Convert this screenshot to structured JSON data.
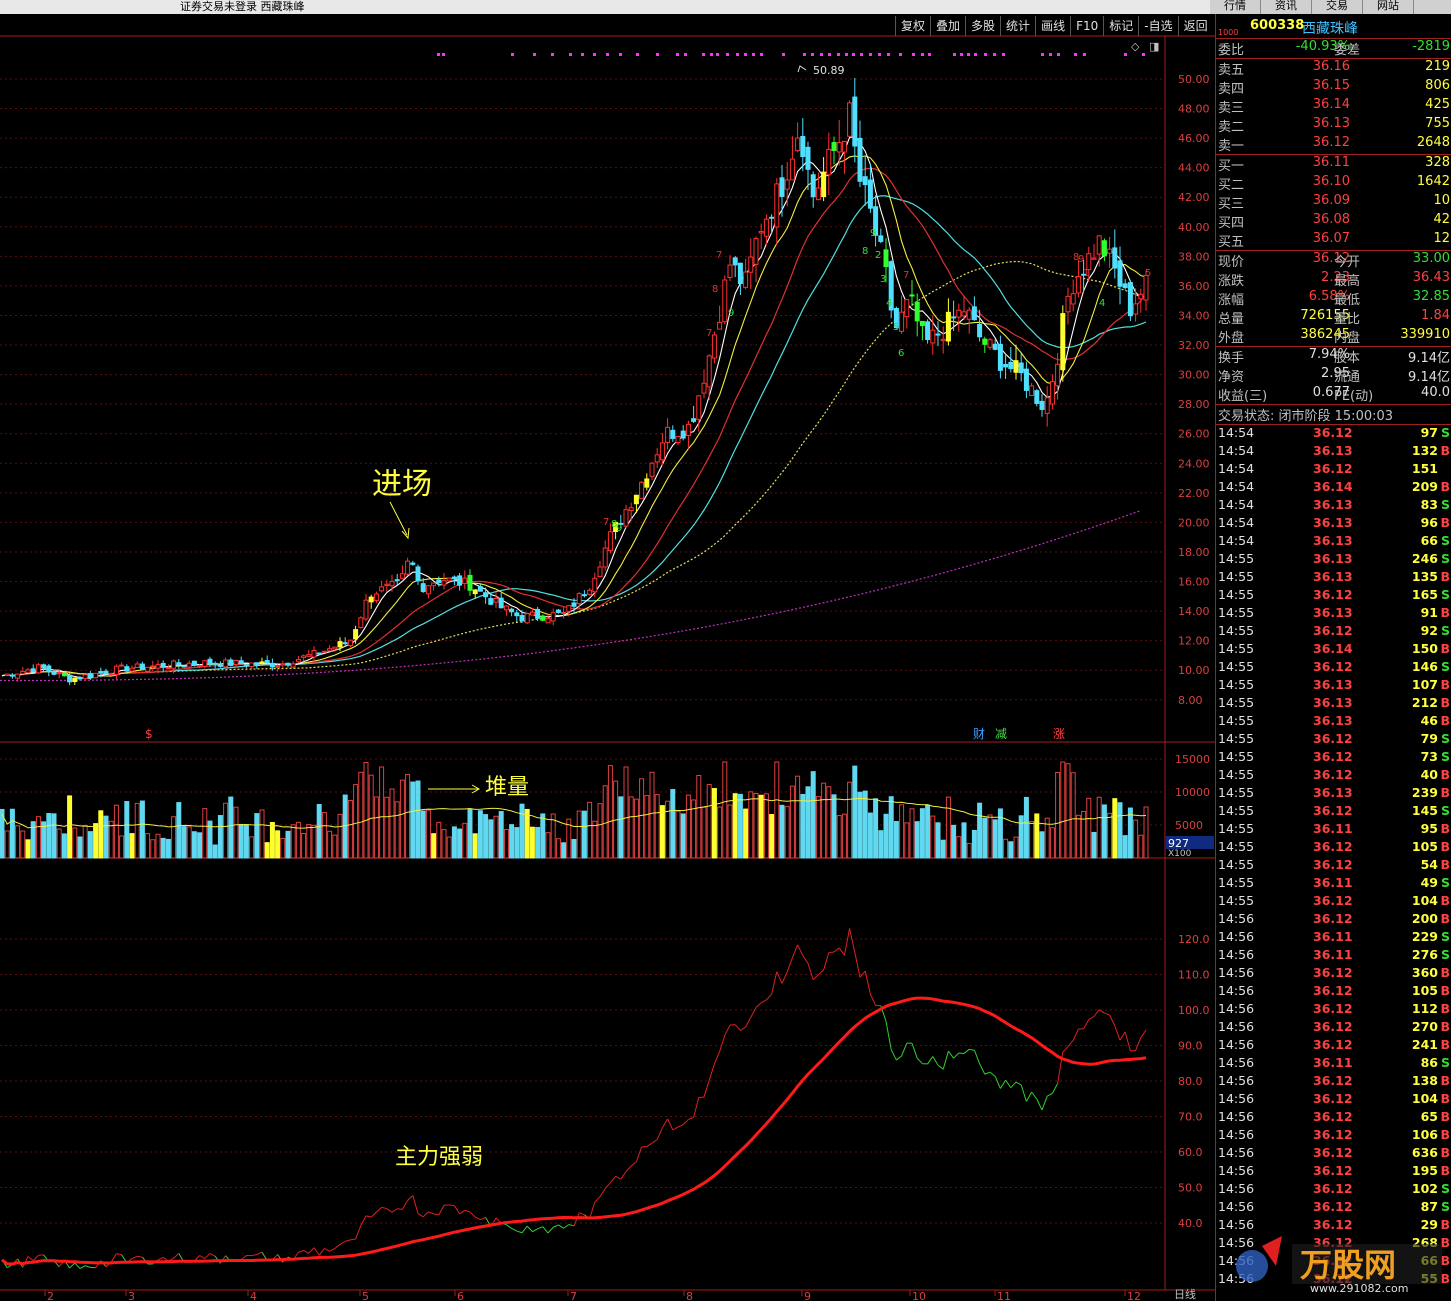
{
  "window": {
    "title": "证券交易未登录  西藏珠峰",
    "toolbar": [
      "复权",
      "叠加",
      "多股",
      "统计",
      "画线",
      "F10",
      "标记",
      "-自选",
      "返回"
    ],
    "menu": [
      "行情",
      "资讯",
      "交易",
      "网站"
    ]
  },
  "chart": {
    "price_ticks": [
      "50.00",
      "48.00",
      "46.00",
      "44.00",
      "42.00",
      "40.00",
      "38.00",
      "36.00",
      "34.00",
      "32.00",
      "30.00",
      "28.00",
      "26.00",
      "24.00",
      "22.00",
      "20.00",
      "18.00",
      "16.00",
      "14.00",
      "12.00",
      "10.00",
      "8.00"
    ],
    "volume_ticks": [
      "15000",
      "10000",
      "5000"
    ],
    "volume_current": "927",
    "volume_unit": "X100",
    "indicator_ticks": [
      "120.0",
      "110.0",
      "100.0",
      "90.0",
      "80.0",
      "70.0",
      "60.0",
      "50.0",
      "40.0"
    ],
    "x_labels": [
      "2",
      "3",
      "4",
      "5",
      "6",
      "7",
      "8",
      "9",
      "10",
      "11",
      "12"
    ],
    "x_unit": "日线",
    "peak_label": "50.89",
    "event_flags": [
      "财",
      "减",
      "涨"
    ],
    "dollar_flag": "$",
    "annotations": {
      "entry": "进场",
      "volume": "堆量",
      "strength": "主力强弱"
    },
    "seq_numbers": [
      "7",
      "8",
      "9",
      "7",
      "8",
      "9",
      "7",
      "8",
      "9",
      "2",
      "3",
      "4",
      "5",
      "6",
      "7",
      "8",
      "9",
      "1",
      "4",
      "5",
      "6",
      "9",
      "1"
    ]
  },
  "quote": {
    "code": "600338",
    "name": "西藏珠峰",
    "tag": "1000",
    "ratio": {
      "label": "委比",
      "value": "-40.93%",
      "label2": "委差",
      "value2": "-2819"
    },
    "asks": [
      {
        "label": "卖五",
        "price": "36.16",
        "vol": "219"
      },
      {
        "label": "卖四",
        "price": "36.15",
        "vol": "806"
      },
      {
        "label": "卖三",
        "price": "36.14",
        "vol": "425"
      },
      {
        "label": "卖二",
        "price": "36.13",
        "vol": "755"
      },
      {
        "label": "卖一",
        "price": "36.12",
        "vol": "2648"
      }
    ],
    "bids": [
      {
        "label": "买一",
        "price": "36.11",
        "vol": "328"
      },
      {
        "label": "买二",
        "price": "36.10",
        "vol": "1642"
      },
      {
        "label": "买三",
        "price": "36.09",
        "vol": "10"
      },
      {
        "label": "买四",
        "price": "36.08",
        "vol": "42"
      },
      {
        "label": "买五",
        "price": "36.07",
        "vol": "12"
      }
    ],
    "stats": [
      {
        "l1": "现价",
        "v1": "36.12",
        "l2": "今开",
        "v2": "33.00"
      },
      {
        "l1": "涨跌",
        "v1": "2.23",
        "l2": "最高",
        "v2": "36.43"
      },
      {
        "l1": "涨幅",
        "v1": "6.58%",
        "l2": "最低",
        "v2": "32.85"
      },
      {
        "l1": "总量",
        "v1": "726155",
        "l2": "量比",
        "v2": "1.84"
      },
      {
        "l1": "外盘",
        "v1": "386245",
        "l2": "内盘",
        "v2": "339910"
      }
    ],
    "stats2": [
      {
        "l1": "换手",
        "v1": "7.94%",
        "l2": "股本",
        "v2": "9.14亿"
      },
      {
        "l1": "净资",
        "v1": "2.95",
        "l2": "流通",
        "v2": "9.14亿"
      },
      {
        "l1": "收益(三)",
        "v1": "0.677",
        "l2": "PE(动)",
        "v2": "40.0"
      }
    ],
    "status": "交易状态: 闭市阶段 15:00:03",
    "ticks": [
      [
        "14:54",
        "36.12",
        "97",
        "S"
      ],
      [
        "14:54",
        "36.13",
        "132",
        "B"
      ],
      [
        "14:54",
        "36.12",
        "151",
        ""
      ],
      [
        "14:54",
        "36.14",
        "209",
        "B"
      ],
      [
        "14:54",
        "36.13",
        "83",
        "S"
      ],
      [
        "14:54",
        "36.13",
        "96",
        "B"
      ],
      [
        "14:54",
        "36.13",
        "66",
        "S"
      ],
      [
        "14:55",
        "36.13",
        "246",
        "S"
      ],
      [
        "14:55",
        "36.13",
        "135",
        "B"
      ],
      [
        "14:55",
        "36.12",
        "165",
        "S"
      ],
      [
        "14:55",
        "36.13",
        "91",
        "B"
      ],
      [
        "14:55",
        "36.12",
        "92",
        "S"
      ],
      [
        "14:55",
        "36.14",
        "150",
        "B"
      ],
      [
        "14:55",
        "36.12",
        "146",
        "S"
      ],
      [
        "14:55",
        "36.13",
        "107",
        "B"
      ],
      [
        "14:55",
        "36.13",
        "212",
        "B"
      ],
      [
        "14:55",
        "36.13",
        "46",
        "B"
      ],
      [
        "14:55",
        "36.12",
        "79",
        "S"
      ],
      [
        "14:55",
        "36.12",
        "73",
        "S"
      ],
      [
        "14:55",
        "36.12",
        "40",
        "B"
      ],
      [
        "14:55",
        "36.13",
        "239",
        "B"
      ],
      [
        "14:55",
        "36.12",
        "145",
        "S"
      ],
      [
        "14:55",
        "36.11",
        "95",
        "B"
      ],
      [
        "14:55",
        "36.12",
        "105",
        "B"
      ],
      [
        "14:55",
        "36.12",
        "54",
        "B"
      ],
      [
        "14:55",
        "36.11",
        "49",
        "S"
      ],
      [
        "14:55",
        "36.12",
        "104",
        "B"
      ],
      [
        "14:56",
        "36.12",
        "200",
        "B"
      ],
      [
        "14:56",
        "36.11",
        "229",
        "S"
      ],
      [
        "14:56",
        "36.11",
        "276",
        "S"
      ],
      [
        "14:56",
        "36.12",
        "360",
        "B"
      ],
      [
        "14:56",
        "36.12",
        "105",
        "B"
      ],
      [
        "14:56",
        "36.12",
        "112",
        "B"
      ],
      [
        "14:56",
        "36.12",
        "270",
        "B"
      ],
      [
        "14:56",
        "36.12",
        "241",
        "B"
      ],
      [
        "14:56",
        "36.11",
        "86",
        "S"
      ],
      [
        "14:56",
        "36.12",
        "138",
        "B"
      ],
      [
        "14:56",
        "36.12",
        "104",
        "B"
      ],
      [
        "14:56",
        "36.12",
        "65",
        "B"
      ],
      [
        "14:56",
        "36.12",
        "106",
        "B"
      ],
      [
        "14:56",
        "36.12",
        "636",
        "B"
      ],
      [
        "14:56",
        "36.12",
        "195",
        "B"
      ],
      [
        "14:56",
        "36.12",
        "102",
        "S"
      ],
      [
        "14:56",
        "36.12",
        "87",
        "S"
      ],
      [
        "14:56",
        "36.12",
        "29",
        "B"
      ],
      [
        "14:56",
        "36.12",
        "268",
        "B"
      ],
      [
        "14:56",
        "36.12",
        "66",
        "B"
      ],
      [
        "14:56",
        "36.12",
        "55",
        "B"
      ]
    ],
    "watermark": "万股网",
    "watermark_url": "www.291082.com"
  }
}
